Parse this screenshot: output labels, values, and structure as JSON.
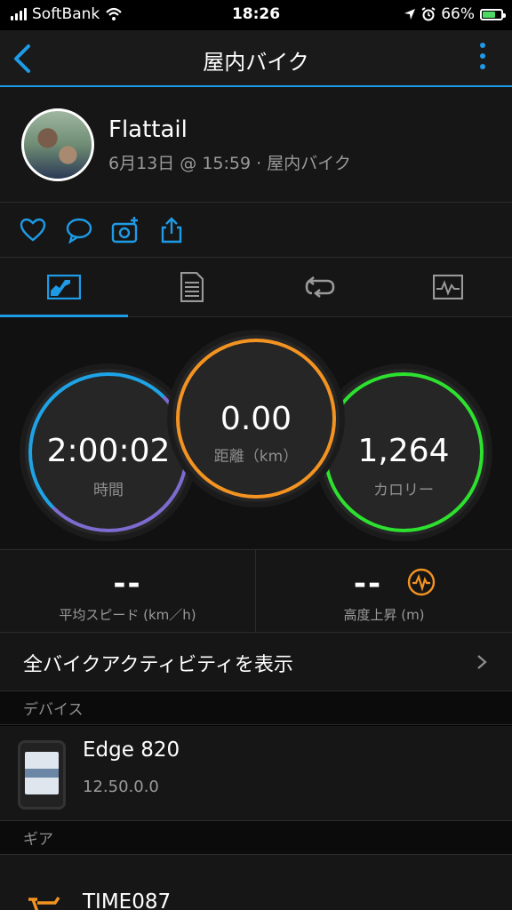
{
  "status_bar": {
    "carrier": "SoftBank",
    "time": "18:26",
    "battery": "66%"
  },
  "nav": {
    "title": "屋内バイク"
  },
  "profile": {
    "name": "Flattail",
    "meta": "6月13日 @ 15:59 · 屋内バイク"
  },
  "stats": {
    "time": {
      "value": "2:00:02",
      "label": "時間"
    },
    "distance": {
      "value": "0.00",
      "label": "距離（km）"
    },
    "calories": {
      "value": "1,264",
      "label": "カロリー"
    }
  },
  "metrics": {
    "avg_speed": {
      "value": "--",
      "label": "平均スピード (km／h)"
    },
    "elevation": {
      "value": "--",
      "label": "高度上昇 (m)"
    }
  },
  "all_activities": {
    "label": "全バイクアクティビティを表示"
  },
  "device_section": {
    "title": "デバイス"
  },
  "device": {
    "name": "Edge 820",
    "version": "12.50.0.0"
  },
  "gear_section": {
    "title": "ギア"
  },
  "gear": {
    "name": "TIME087"
  },
  "colors": {
    "accent": "#1e9be6",
    "time_ring": "#7e6bd0",
    "distance_ring": "#f39322",
    "calories_ring": "#2de12f",
    "elevation_icon": "#f39322"
  }
}
